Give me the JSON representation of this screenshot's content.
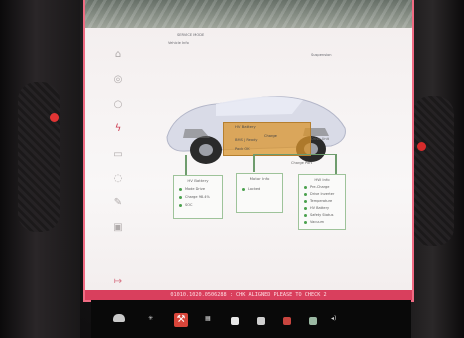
{
  "header": {
    "label_left_top": "SERVICE MODE",
    "label_left_sub": "Vehicle Info",
    "label_right_top": "Suspension"
  },
  "sidebar": {
    "items": [
      {
        "icon": "home-icon",
        "glyph": "⌂"
      },
      {
        "icon": "power-icon",
        "glyph": "◎"
      },
      {
        "icon": "circle-icon",
        "glyph": "○"
      },
      {
        "icon": "bolt-icon",
        "glyph": "ϟ"
      },
      {
        "icon": "battery-icon",
        "glyph": "▭"
      },
      {
        "icon": "gauge-icon",
        "glyph": "◌"
      },
      {
        "icon": "pen-icon",
        "glyph": "✎"
      },
      {
        "icon": "car-icon",
        "glyph": "▣"
      },
      {
        "icon": "exit-icon",
        "glyph": "↦"
      }
    ]
  },
  "diagram": {
    "battery_label": "HV Battery",
    "battery_state": "Charge",
    "battery_note": "BMS | Ready",
    "pack_line_2": "Pack OK",
    "inverter": "Drive Unit",
    "charger": "Charge Port"
  },
  "panels": {
    "left": {
      "title": "HV Battery",
      "rows": [
        {
          "label": "Mode",
          "value": "Drive"
        },
        {
          "label": "Charge",
          "value": "98.4%"
        },
        {
          "label": "SOC",
          "value": ""
        }
      ]
    },
    "center": {
      "title": "Motor Info",
      "rows": [
        {
          "label": "Locked",
          "value": ""
        },
        {
          "label": "",
          "value": ""
        }
      ]
    },
    "right": {
      "title": "HW Info",
      "rows": [
        {
          "label": "Pre-Charge",
          "value": ""
        },
        {
          "label": "Drive Inverter",
          "value": ""
        },
        {
          "label": "Temperature",
          "value": ""
        },
        {
          "label": "HV Battery",
          "value": ""
        },
        {
          "label": "Safety Status",
          "value": ""
        },
        {
          "label": "Vacuum",
          "value": ""
        }
      ]
    }
  },
  "alert": {
    "text": "01010.1020.0506288 :  CHK ALIGNED  PLEASE TO CHECK 2"
  },
  "footer": {
    "left_temp": "",
    "icons": [
      {
        "icon": "car-icon",
        "glyph": "▰"
      },
      {
        "icon": "fan-icon",
        "glyph": "✳"
      },
      {
        "icon": "wrench-icon",
        "glyph": "🔧"
      },
      {
        "icon": "grid-icon",
        "glyph": "▦"
      },
      {
        "icon": "square-icon",
        "glyph": "■"
      },
      {
        "icon": "square-icon",
        "glyph": "■"
      },
      {
        "icon": "apps-icon",
        "glyph": "▤"
      },
      {
        "icon": "apps-icon",
        "glyph": "▥"
      },
      {
        "icon": "volume-icon",
        "glyph": "◂)"
      }
    ]
  },
  "colors": {
    "accent": "#f06b83",
    "alert_bg": "#d93f5d",
    "ok": "#4aa14d"
  }
}
